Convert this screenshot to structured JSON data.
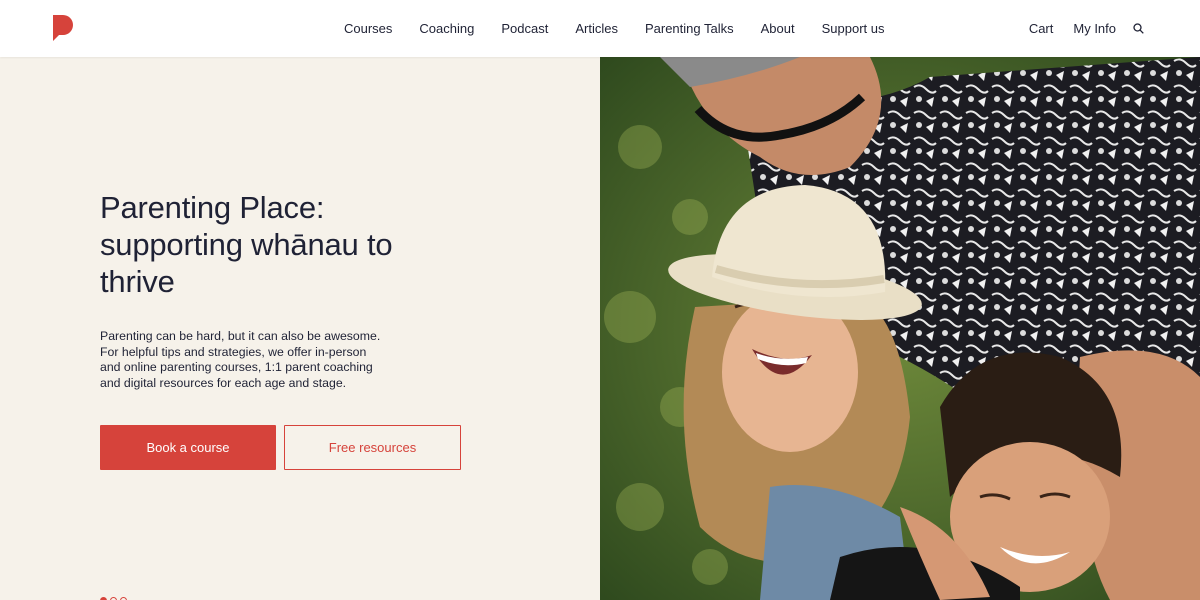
{
  "header": {
    "logo_name": "parenting-place-logo",
    "nav": [
      {
        "label": "Courses"
      },
      {
        "label": "Coaching"
      },
      {
        "label": "Podcast"
      },
      {
        "label": "Articles"
      },
      {
        "label": "Parenting Talks"
      },
      {
        "label": "About"
      },
      {
        "label": "Support us"
      }
    ],
    "cart_label": "Cart",
    "myinfo_label": "My Info",
    "search_icon": "search-icon"
  },
  "hero": {
    "title": "Parenting Place: supporting whānau to thrive",
    "body": "Parenting can be hard, but it can also be awesome. For helpful tips and strategies, we offer in-person and online parenting courses, 1:1 parent coaching and digital resources for each age and stage.",
    "primary_button": "Book a course",
    "secondary_button": "Free resources",
    "slides": 3,
    "active_slide": 1
  },
  "colors": {
    "brand_red": "#d6433b",
    "hero_bg": "#f6f2ea",
    "text": "#1f2235"
  }
}
